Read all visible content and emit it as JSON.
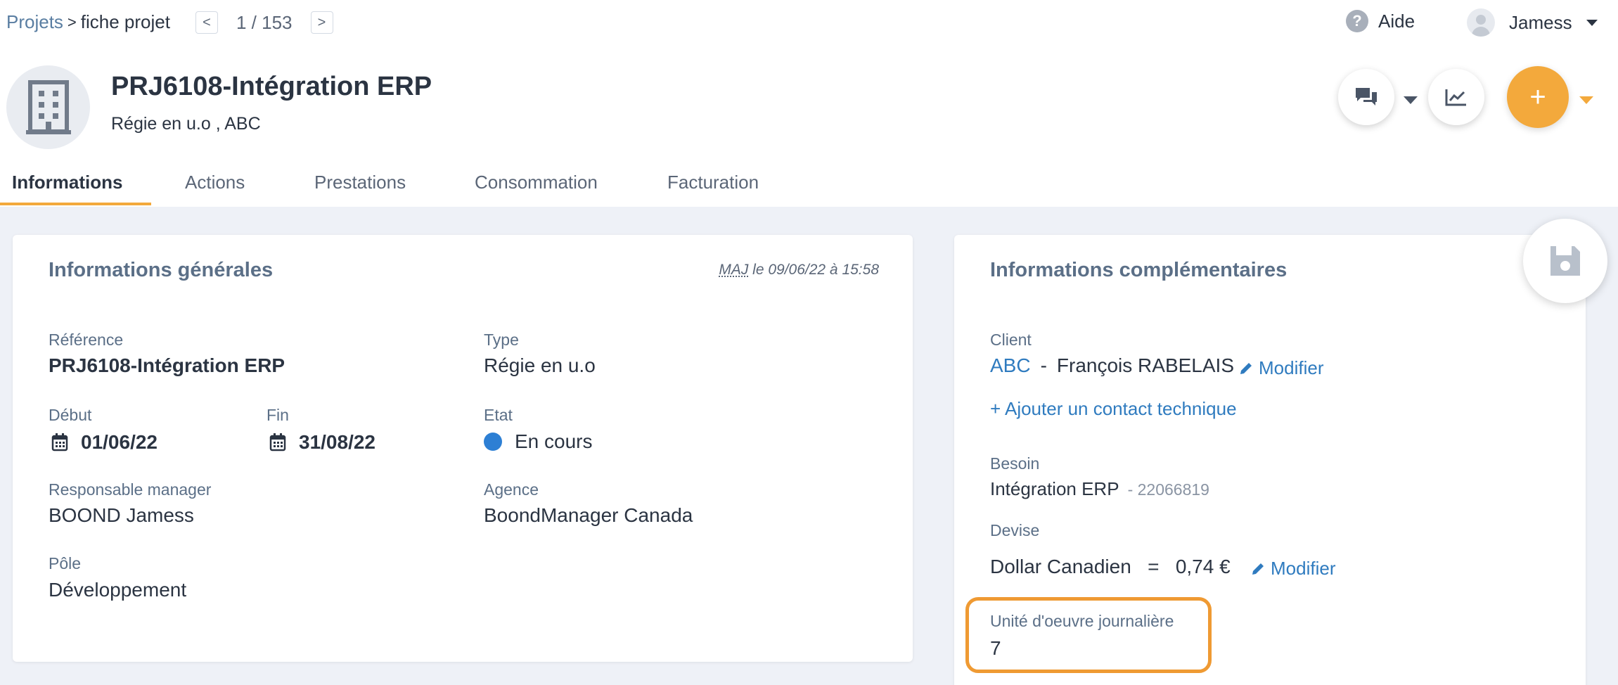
{
  "breadcrumb": {
    "root": "Projets",
    "separator": ">",
    "current": "fiche projet"
  },
  "pager": {
    "prev": "<",
    "count": "1 / 153",
    "next": ">"
  },
  "help": {
    "icon": "?",
    "label": "Aide"
  },
  "user": {
    "name": "Jamess"
  },
  "project": {
    "title": "PRJ6108-Intégration ERP",
    "type_subtitle": "Régie en u.o ,",
    "client_subtitle": "ABC"
  },
  "actions": {
    "add_label": "+"
  },
  "tabs": [
    {
      "label": "Informations",
      "active": true
    },
    {
      "label": "Actions"
    },
    {
      "label": "Prestations"
    },
    {
      "label": "Consommation"
    },
    {
      "label": "Facturation"
    }
  ],
  "general": {
    "title": "Informations générales",
    "maj_abbr": "MAJ",
    "maj_text": "le 09/06/22 à 15:58",
    "reference_label": "Référence",
    "reference_value": "PRJ6108-Intégration ERP",
    "type_label": "Type",
    "type_value": "Régie en u.o",
    "start_label": "Début",
    "start_value": "01/06/22",
    "end_label": "Fin",
    "end_value": "31/08/22",
    "state_label": "Etat",
    "state_value": "En cours",
    "manager_label": "Responsable manager",
    "manager_value": "BOOND Jamess",
    "agency_label": "Agence",
    "agency_value": "BoondManager Canada",
    "pole_label": "Pôle",
    "pole_value": "Développement"
  },
  "complementary": {
    "title": "Informations complémentaires",
    "client_label": "Client",
    "client_company": "ABC",
    "client_dash": "-",
    "client_contact": "François RABELAIS",
    "modify_label": "Modifier",
    "add_contact": "+ Ajouter un contact technique",
    "need_label": "Besoin",
    "need_value": "Intégration ERP",
    "need_ref": "- 22066819",
    "currency_label": "Devise",
    "currency_value": "Dollar Canadien   =   0,74 €",
    "daily_unit_label": "Unité d'oeuvre journalière",
    "daily_unit_value": "7"
  },
  "colors": {
    "accent": "#f3a93c",
    "link": "#2f7bbf",
    "status": "#2d7fd4",
    "highlight": "#ef9a33"
  }
}
